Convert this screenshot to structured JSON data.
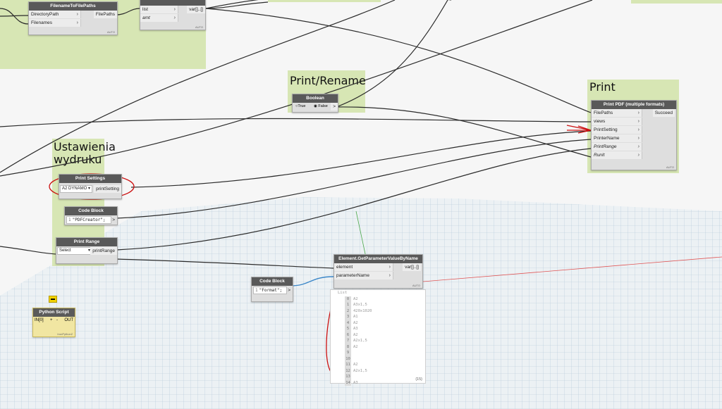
{
  "groups": {
    "print_rename": "Print/Rename",
    "print": "Print",
    "settings": "Ustawienia\nwydruku"
  },
  "nodes": {
    "filename_to_filepaths": {
      "title": "FilenameToFilePaths",
      "inputs": [
        "DirectoryPath",
        "Filenames"
      ],
      "output": "FilePaths",
      "footer": "AUTO"
    },
    "flatten": {
      "inputs": [
        "list",
        "amt"
      ],
      "output": "var[]..[]",
      "footer": "AUTO"
    },
    "boolean": {
      "title": "Boolean",
      "true_label": "True",
      "false_label": "False",
      "output": ">"
    },
    "print_pdf": {
      "title": "Print PDF (multiple formats)",
      "inputs": [
        "FilePaths",
        "views",
        "PrintSetting",
        "PrinterName",
        "PrintRange",
        "RunIt"
      ],
      "output": "Succeed",
      "footer": "AUTO"
    },
    "print_settings": {
      "title": "Print Settings",
      "value": "A2 DYNAMO",
      "output": "printSetting"
    },
    "code_block_1": {
      "title": "Code Block",
      "line": "1",
      "code": "\"PDFCreator\";",
      "output": ">"
    },
    "print_range": {
      "title": "Print Range",
      "value": "Select",
      "output": "printRange"
    },
    "get_param": {
      "title": "Element.GetParameterValueByName",
      "inputs": [
        "element",
        "parameterName"
      ],
      "output": "var[]..[]",
      "footer": "AUTO"
    },
    "code_block_2": {
      "title": "Code Block",
      "line": "1",
      "code": "\"Format\";",
      "output": ">"
    },
    "python": {
      "title": "Python Script",
      "input": "IN[0]",
      "plus": "+",
      "minus": "-",
      "output": "OUT",
      "footer": "IronPython2"
    }
  },
  "watch": {
    "header": "List",
    "items": [
      {
        "i": "0",
        "v": "A2"
      },
      {
        "i": "1",
        "v": "A3x1,5"
      },
      {
        "i": "2",
        "v": "420x1020"
      },
      {
        "i": "3",
        "v": "A1"
      },
      {
        "i": "4",
        "v": "A2"
      },
      {
        "i": "5",
        "v": "A3"
      },
      {
        "i": "6",
        "v": "A2"
      },
      {
        "i": "7",
        "v": "A2x1,5"
      },
      {
        "i": "8",
        "v": "A2"
      },
      {
        "i": "9",
        "v": ""
      },
      {
        "i": "10",
        "v": ""
      },
      {
        "i": "11",
        "v": "A2"
      },
      {
        "i": "12",
        "v": "A2x1,5"
      },
      {
        "i": "13",
        "v": ""
      },
      {
        "i": "14",
        "v": "A3"
      }
    ],
    "count": "{15}"
  },
  "colors": {
    "group_fill": "#d7e6b4",
    "node_header": "#595959",
    "wire": "#2b2b2b",
    "annotation_red": "#cc1111",
    "code_wire": "#3a86c8"
  }
}
